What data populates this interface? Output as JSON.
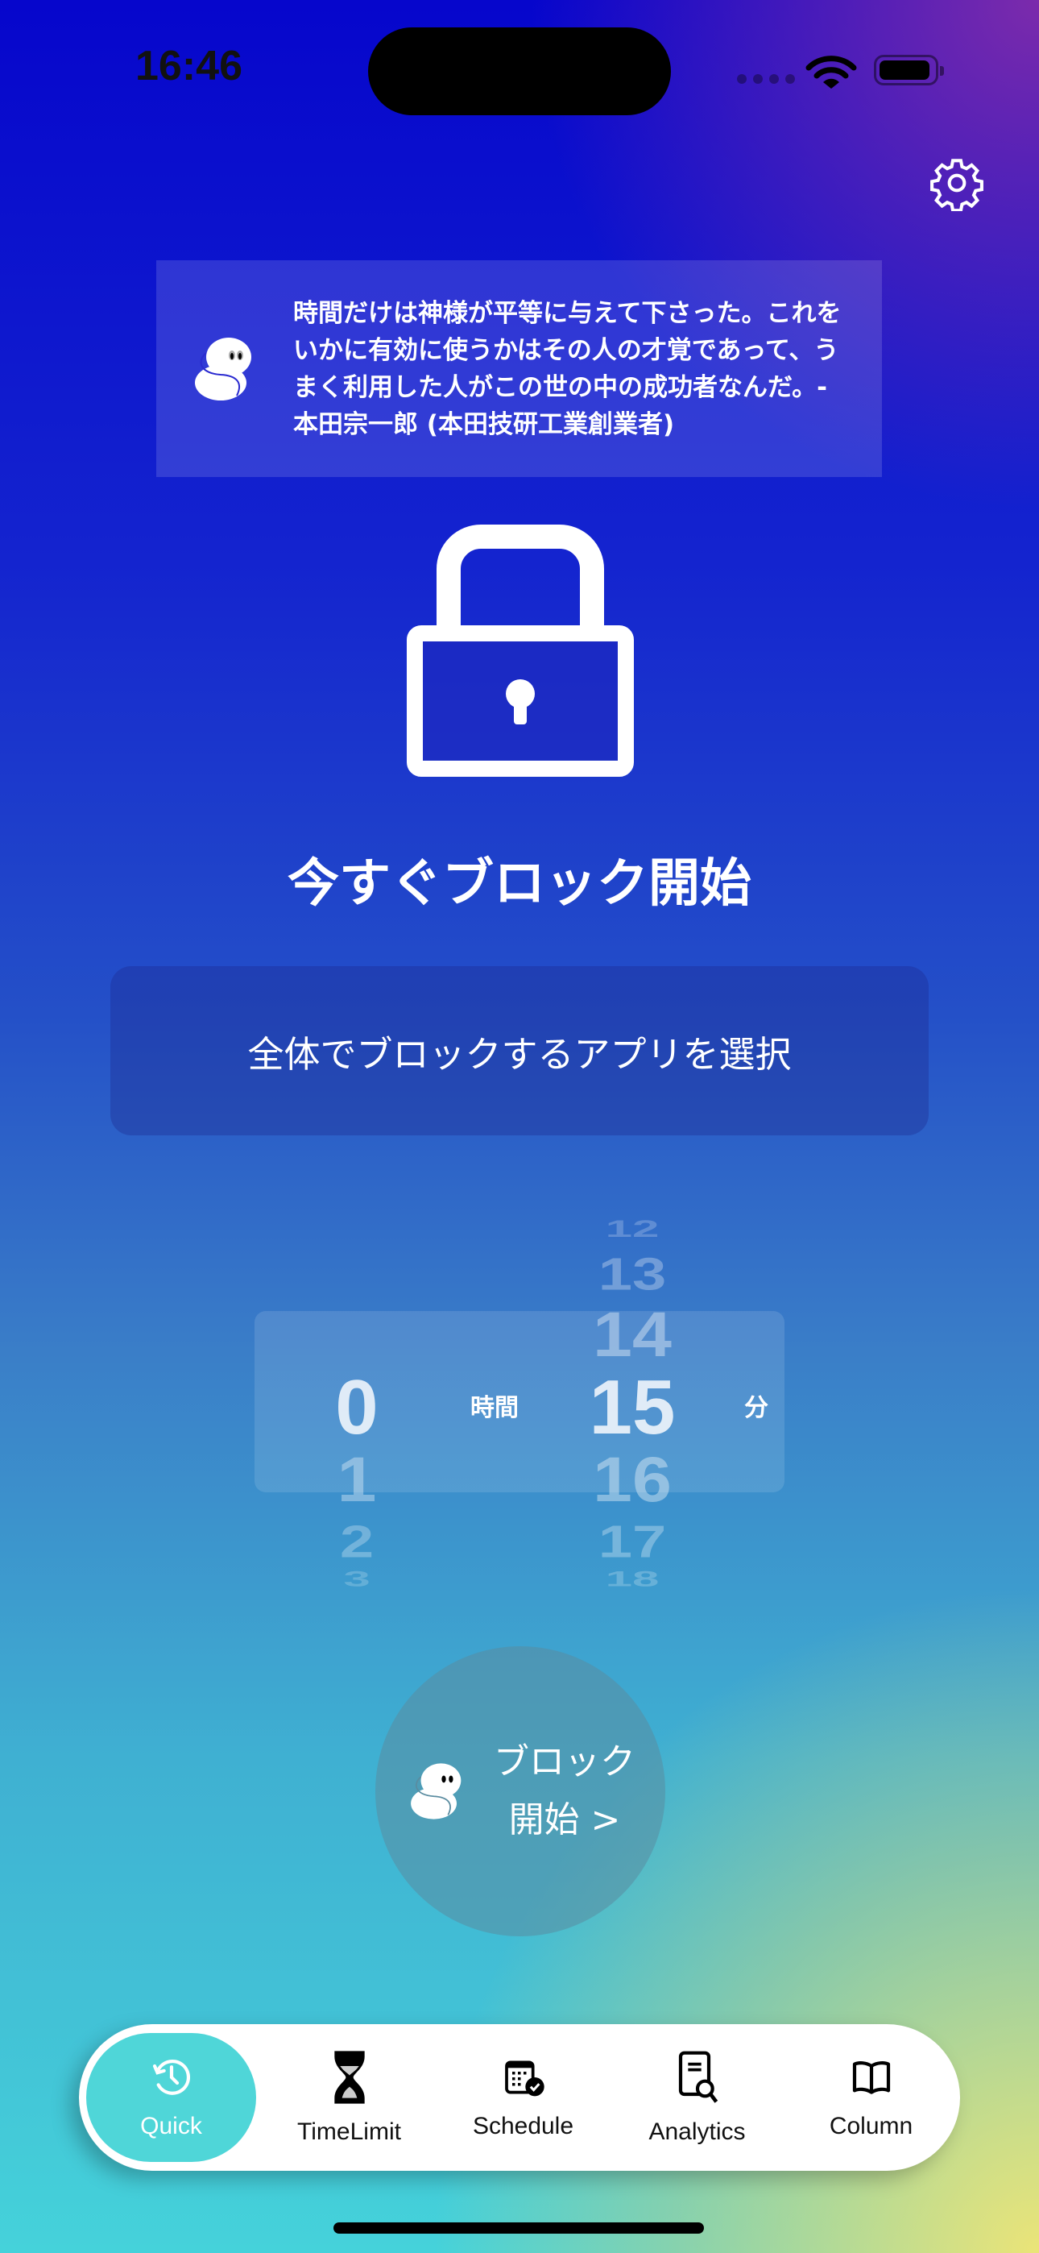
{
  "status_bar": {
    "time": "16:46"
  },
  "quote": {
    "text": "時間だけは神様が平等に与えて下さった。これをいかに有効に使うかはその人の才覚であって、うまく利用した人がこの世の中の成功者なんだ。- 本田宗一郎 (本田技研工業創業者)"
  },
  "main": {
    "title": "今すぐブロック開始",
    "select_apps_label": "全体でブロックするアプリを選択"
  },
  "picker": {
    "hours": {
      "values": [
        "0",
        "1",
        "2",
        "3"
      ],
      "selected": "0",
      "unit": "時間"
    },
    "minutes": {
      "values": [
        "12",
        "13",
        "14",
        "15",
        "16",
        "17",
        "18"
      ],
      "selected": "15",
      "unit": "分"
    }
  },
  "start_button": {
    "line1": "ブロック",
    "line2": "開始 >"
  },
  "tabs": [
    {
      "label": "Quick",
      "icon": "clock-history-icon",
      "active": true
    },
    {
      "label": "TimeLimit",
      "icon": "hourglass-icon",
      "active": false
    },
    {
      "label": "Schedule",
      "icon": "calendar-check-icon",
      "active": false
    },
    {
      "label": "Analytics",
      "icon": "document-search-icon",
      "active": false
    },
    {
      "label": "Column",
      "icon": "book-icon",
      "active": false
    }
  ],
  "colors": {
    "active_tab": "#4fd6d8",
    "gradient_top": "#0606cc",
    "gradient_bottom_left": "#45d2da",
    "gradient_bottom_right": "#ebe478",
    "gradient_top_right": "#822daa"
  }
}
